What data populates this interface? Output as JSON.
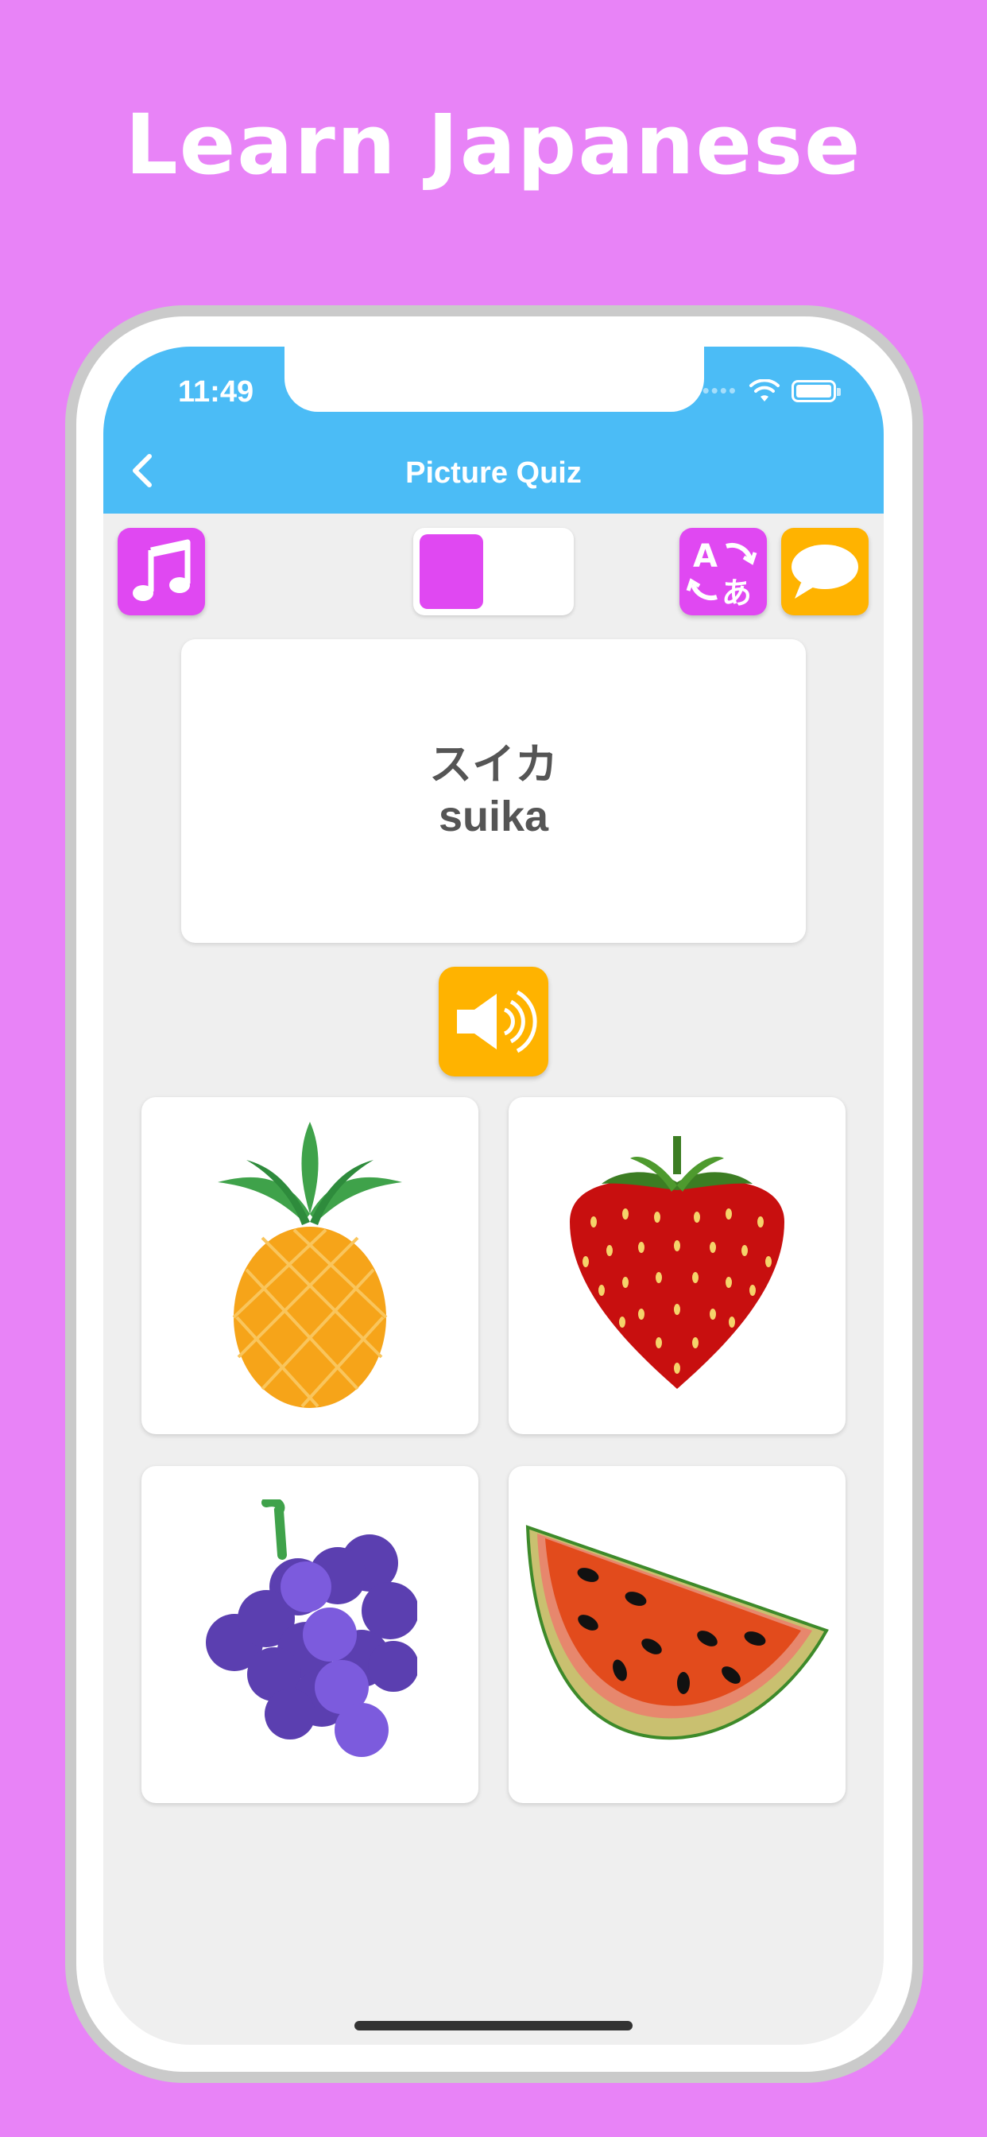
{
  "headline": "Learn Japanese",
  "status_bar": {
    "time": "11:49"
  },
  "nav": {
    "title": "Picture Quiz"
  },
  "toolbar": {
    "music_icon": "music-note-icon",
    "toggle_state": "left",
    "translate_icon": "translate-a-to-hiragana-icon",
    "chat_icon": "speech-bubble-icon"
  },
  "quiz": {
    "word_japanese": "スイカ",
    "word_romaji": "suika",
    "audio_icon": "speaker-icon"
  },
  "choices": [
    {
      "icon": "pineapple-icon"
    },
    {
      "icon": "strawberry-icon"
    },
    {
      "icon": "grapes-icon"
    },
    {
      "icon": "watermelon-icon"
    }
  ],
  "colors": {
    "background": "#E883F7",
    "appbar": "#4BBCF6",
    "magenta_button": "#E048F2",
    "orange_button": "#FFB300"
  }
}
